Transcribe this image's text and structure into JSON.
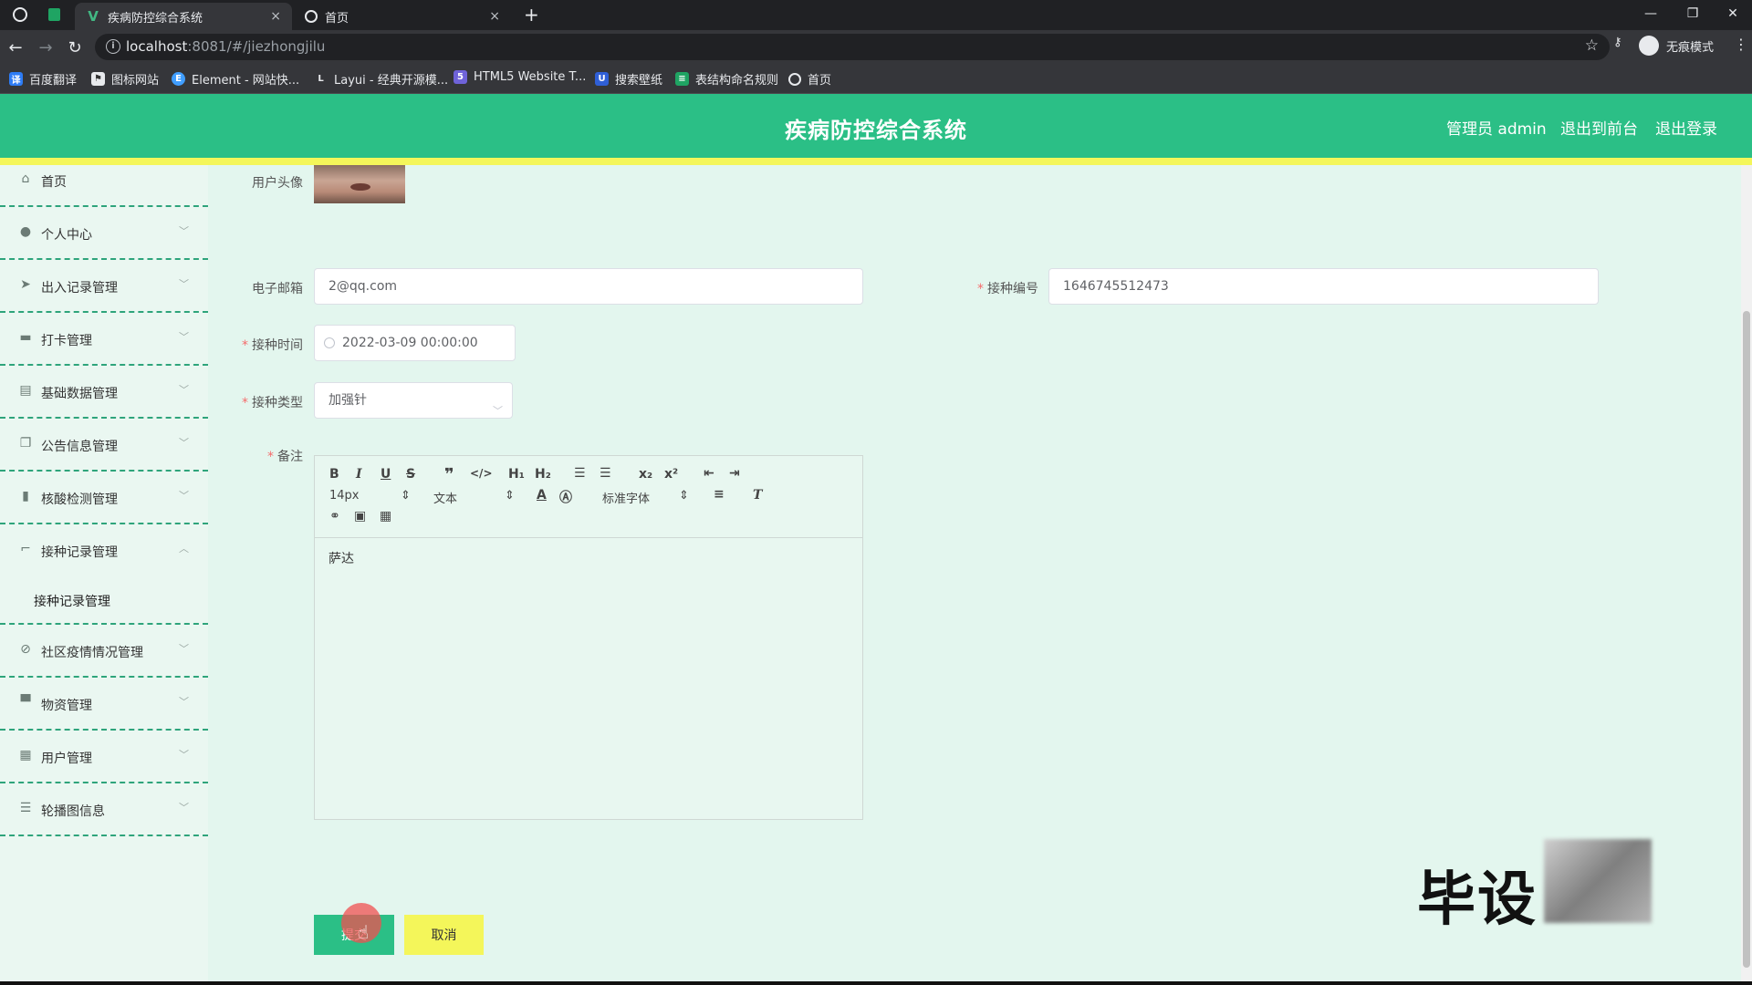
{
  "browser": {
    "tabs": [
      {
        "title": "疾病防控综合系统",
        "close": "×"
      },
      {
        "title": "首页",
        "close": "×"
      }
    ],
    "new_tab": "+",
    "url_host": "localhost",
    "url_rest": ":8081/#/jiezhongjilu",
    "incognito_label": "无痕模式",
    "window_controls": [
      "—",
      "❐",
      "✕"
    ],
    "bookmarks": [
      {
        "label": "百度翻译",
        "icon": "translate-icon",
        "color": "#2d7cf6"
      },
      {
        "label": "图标网站",
        "icon": "flag-icon",
        "color": "#333"
      },
      {
        "label": "Element - 网站快...",
        "icon": "element-icon",
        "color": "#409eff"
      },
      {
        "label": "Layui - 经典开源模...",
        "icon": "layui-icon",
        "color": "#555"
      },
      {
        "label": "HTML5 Website T...",
        "icon": "html5-icon",
        "color": "#6f63d9"
      },
      {
        "label": "搜索壁纸",
        "icon": "wallpaper-icon",
        "color": "#2f5fd6"
      },
      {
        "label": "表结构命名规则",
        "icon": "table-icon",
        "color": "#1fa463"
      },
      {
        "label": "首页",
        "icon": "globe-icon",
        "color": "#333"
      }
    ]
  },
  "header": {
    "title": "疾病防控综合系统",
    "admin": "管理员 admin",
    "to_front": "退出到前台",
    "logout": "退出登录"
  },
  "sidebar": {
    "items": [
      {
        "label": "首页",
        "icon": "home-icon",
        "chev": ""
      },
      {
        "label": "个人中心",
        "icon": "user-icon",
        "chev": "﹀"
      },
      {
        "label": "出入记录管理",
        "icon": "send-icon",
        "chev": "﹀"
      },
      {
        "label": "打卡管理",
        "icon": "briefcase-icon",
        "chev": "﹀"
      },
      {
        "label": "基础数据管理",
        "icon": "clipboard-icon",
        "chev": "﹀"
      },
      {
        "label": "公告信息管理",
        "icon": "copy-icon",
        "chev": "﹀"
      },
      {
        "label": "核酸检测管理",
        "icon": "bar-chart-icon",
        "chev": "﹀"
      },
      {
        "label": "接种记录管理",
        "icon": "crop-icon",
        "chev": "︿"
      },
      {
        "label": "社区疫情情况管理",
        "icon": "compass-icon",
        "chev": "﹀"
      },
      {
        "label": "物资管理",
        "icon": "box-icon",
        "chev": "﹀"
      },
      {
        "label": "用户管理",
        "icon": "clipboard-user-icon",
        "chev": "﹀"
      },
      {
        "label": "轮播图信息",
        "icon": "sliders-icon",
        "chev": "﹀"
      }
    ],
    "active_sub": "接种记录管理"
  },
  "form": {
    "avatar_label": "用户头像",
    "email_label": "电子邮箱",
    "email_value": "2@qq.com",
    "code_label": "接种编号",
    "code_value": "1646745512473",
    "time_label": "接种时间",
    "time_value": "2022-03-09 00:00:00",
    "type_label": "接种类型",
    "type_value": "加强针",
    "note_label": "备注",
    "note_value": "萨达",
    "required_mark": "*",
    "submit": "提交",
    "cancel": "取消"
  },
  "editor": {
    "size": "14px",
    "format": "文本",
    "font": "标准字体",
    "h1": "H₁",
    "h2": "H₂",
    "sub": "x₂",
    "sup": "x²"
  },
  "watermark": "毕设"
}
